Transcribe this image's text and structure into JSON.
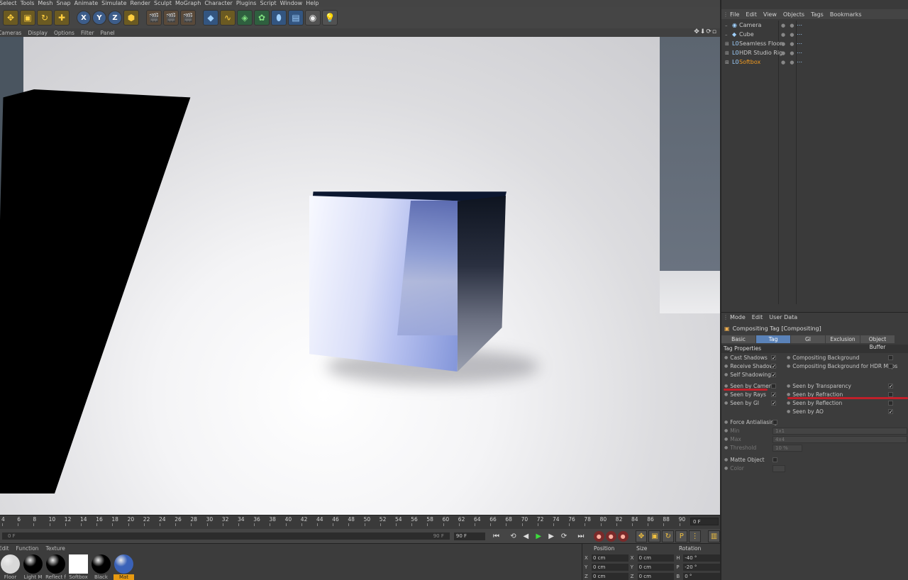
{
  "menubar": [
    "Select",
    "Tools",
    "Mesh",
    "Snap",
    "Animate",
    "Simulate",
    "Render",
    "Sculpt",
    "MoGraph",
    "Character",
    "Plugins",
    "Script",
    "Window",
    "Help"
  ],
  "toolbar": {
    "axis_labels": [
      "X",
      "Y",
      "Z"
    ]
  },
  "viewport_menu": [
    "Cameras",
    "Display",
    "Options",
    "Filter",
    "Panel"
  ],
  "viewport_nav_glyphs": "✥⬇⟳▫",
  "timeline": {
    "ticks": [
      "4",
      "6",
      "8",
      "10",
      "12",
      "14",
      "16",
      "18",
      "20",
      "22",
      "24",
      "26",
      "28",
      "30",
      "32",
      "34",
      "36",
      "38",
      "40",
      "42",
      "44",
      "46",
      "48",
      "50",
      "52",
      "54",
      "56",
      "58",
      "60",
      "62",
      "64",
      "66",
      "68",
      "70",
      "72",
      "74",
      "76",
      "78",
      "80",
      "82",
      "84",
      "86",
      "88",
      "90"
    ],
    "current_frame": "0 F"
  },
  "transport": {
    "slider_start": "0 F",
    "slider_end": "90 F",
    "end_field": "90 F"
  },
  "material_menu": [
    "Edit",
    "Function",
    "Texture"
  ],
  "materials": [
    {
      "name": "Floor",
      "color": "#d8d8d8"
    },
    {
      "name": "Light M",
      "color": "#000000"
    },
    {
      "name": "Reflect f",
      "color": "#000000"
    },
    {
      "name": "Softbox",
      "color": "#ffffff"
    },
    {
      "name": "Black",
      "color": "#000000"
    },
    {
      "name": "Mat",
      "color": "#3a62b8",
      "selected": true
    }
  ],
  "coords": {
    "headers": [
      "Position",
      "Size",
      "Rotation"
    ],
    "rows": [
      {
        "axis": "X",
        "pos": "0 cm",
        "size_axis": "X",
        "size": "0 cm",
        "rot_axis": "H",
        "rot": "-40 °"
      },
      {
        "axis": "Y",
        "pos": "0 cm",
        "size_axis": "Y",
        "size": "0 cm",
        "rot_axis": "P",
        "rot": "-20 °"
      },
      {
        "axis": "Z",
        "pos": "0 cm",
        "size_axis": "Z",
        "size": "0 cm",
        "rot_axis": "B",
        "rot": "0 °"
      }
    ]
  },
  "object_manager": {
    "menu": [
      "File",
      "Edit",
      "View",
      "Objects",
      "Tags",
      "Bookmarks"
    ],
    "objects": [
      {
        "name": "Camera",
        "icon": "camera-icon",
        "active": false
      },
      {
        "name": "Cube",
        "icon": "cube-icon",
        "active": false
      },
      {
        "name": "Seamless Floor",
        "icon": "null-icon",
        "active": false
      },
      {
        "name": "HDR Studio Rig",
        "icon": "null-icon",
        "active": false
      },
      {
        "name": "Softbox",
        "icon": "null-icon",
        "active": true
      }
    ]
  },
  "attributes": {
    "menu": [
      "Mode",
      "Edit",
      "User Data"
    ],
    "title": "Compositing Tag [Compositing]",
    "tabs": [
      "Basic",
      "Tag",
      "GI",
      "Exclusion",
      "Object Buffer"
    ],
    "selected_tab": "Tag",
    "section": "Tag Properties",
    "left_props": [
      {
        "label": "Cast Shadows",
        "checked": true
      },
      {
        "label": "Receive Shadows",
        "checked": true
      },
      {
        "label": "Self Shadowing",
        "checked": true
      },
      {
        "label": "Seen by Camera",
        "checked": false
      },
      {
        "label": "Seen by Rays",
        "checked": true
      },
      {
        "label": "Seen by GI",
        "checked": true
      }
    ],
    "right_props": [
      {
        "label": "Compositing Background",
        "checked": false
      },
      {
        "label": "Compositing Background for HDR Maps",
        "checked": false
      },
      {
        "label": "Seen by Transparency",
        "checked": true
      },
      {
        "label": "Seen by Refraction",
        "checked": false
      },
      {
        "label": "Seen by Reflection",
        "checked": false
      },
      {
        "label": "Seen by AO",
        "checked": true
      }
    ],
    "force_aa": "Force Antialiasing",
    "min_label": "Min",
    "min_value": "1x1",
    "max_label": "Max",
    "max_value": "4x4",
    "threshold_label": "Threshold",
    "threshold_value": "10 %",
    "matte_label": "Matte Object",
    "color_label": "Color"
  },
  "colors": {
    "accent": "#f09a20",
    "tab_selected": "#5a82b8",
    "annotation_red": "#c0202a"
  }
}
